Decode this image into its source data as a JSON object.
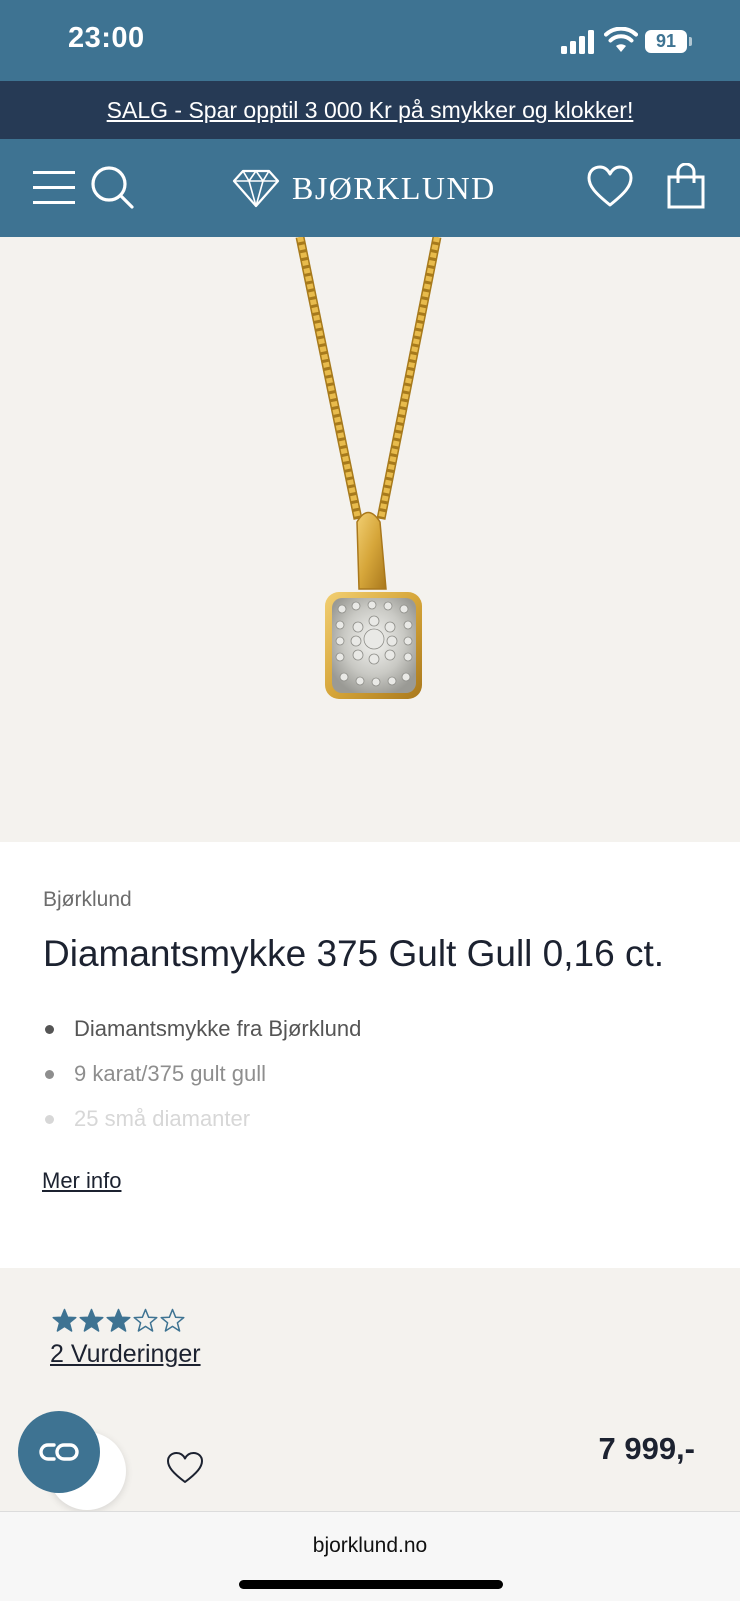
{
  "status_bar": {
    "time": "23:00",
    "battery": "91",
    "icons": [
      "cellular-signal-icon",
      "wifi-icon",
      "battery-icon"
    ]
  },
  "promo": {
    "text": "SALG - Spar opptil 3 000 Kr på smykker og klokker!"
  },
  "header": {
    "logo_text": "BJØRKLUND",
    "icons": [
      "menu-icon",
      "search-icon",
      "diamond-logo-icon",
      "heart-icon",
      "shopping-bag-icon"
    ]
  },
  "product": {
    "brand": "Bjørklund",
    "title": "Diamantsmykke 375 Gult Gull 0,16 ct.",
    "features": [
      "Diamantsmykke fra Bjørklund",
      "9 karat/375 gult gull",
      "25 små diamanter"
    ],
    "more_info": "Mer info",
    "rating": 3,
    "rating_max": 5,
    "reviews_label": "2 Vurderinger",
    "price": "7 999,-"
  },
  "browser": {
    "url": "bjorklund.no"
  },
  "colors": {
    "header_teal": "#3e7392",
    "promo_navy": "#263a55",
    "image_bg": "#f4f2ee",
    "gold": "#d6a63a"
  }
}
